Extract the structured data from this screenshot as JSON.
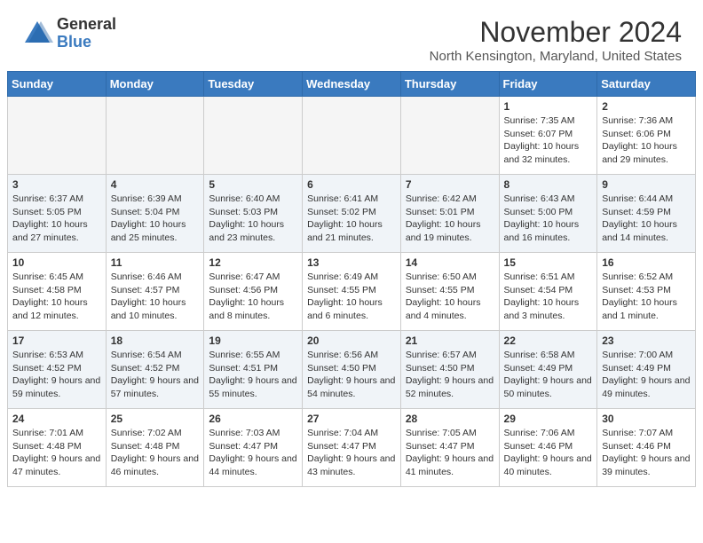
{
  "header": {
    "logo_general": "General",
    "logo_blue": "Blue",
    "title": "November 2024",
    "location": "North Kensington, Maryland, United States"
  },
  "days_of_week": [
    "Sunday",
    "Monday",
    "Tuesday",
    "Wednesday",
    "Thursday",
    "Friday",
    "Saturday"
  ],
  "weeks": [
    [
      {
        "day": "",
        "info": ""
      },
      {
        "day": "",
        "info": ""
      },
      {
        "day": "",
        "info": ""
      },
      {
        "day": "",
        "info": ""
      },
      {
        "day": "",
        "info": ""
      },
      {
        "day": "1",
        "info": "Sunrise: 7:35 AM\nSunset: 6:07 PM\nDaylight: 10 hours and 32 minutes."
      },
      {
        "day": "2",
        "info": "Sunrise: 7:36 AM\nSunset: 6:06 PM\nDaylight: 10 hours and 29 minutes."
      }
    ],
    [
      {
        "day": "3",
        "info": "Sunrise: 6:37 AM\nSunset: 5:05 PM\nDaylight: 10 hours and 27 minutes."
      },
      {
        "day": "4",
        "info": "Sunrise: 6:39 AM\nSunset: 5:04 PM\nDaylight: 10 hours and 25 minutes."
      },
      {
        "day": "5",
        "info": "Sunrise: 6:40 AM\nSunset: 5:03 PM\nDaylight: 10 hours and 23 minutes."
      },
      {
        "day": "6",
        "info": "Sunrise: 6:41 AM\nSunset: 5:02 PM\nDaylight: 10 hours and 21 minutes."
      },
      {
        "day": "7",
        "info": "Sunrise: 6:42 AM\nSunset: 5:01 PM\nDaylight: 10 hours and 19 minutes."
      },
      {
        "day": "8",
        "info": "Sunrise: 6:43 AM\nSunset: 5:00 PM\nDaylight: 10 hours and 16 minutes."
      },
      {
        "day": "9",
        "info": "Sunrise: 6:44 AM\nSunset: 4:59 PM\nDaylight: 10 hours and 14 minutes."
      }
    ],
    [
      {
        "day": "10",
        "info": "Sunrise: 6:45 AM\nSunset: 4:58 PM\nDaylight: 10 hours and 12 minutes."
      },
      {
        "day": "11",
        "info": "Sunrise: 6:46 AM\nSunset: 4:57 PM\nDaylight: 10 hours and 10 minutes."
      },
      {
        "day": "12",
        "info": "Sunrise: 6:47 AM\nSunset: 4:56 PM\nDaylight: 10 hours and 8 minutes."
      },
      {
        "day": "13",
        "info": "Sunrise: 6:49 AM\nSunset: 4:55 PM\nDaylight: 10 hours and 6 minutes."
      },
      {
        "day": "14",
        "info": "Sunrise: 6:50 AM\nSunset: 4:55 PM\nDaylight: 10 hours and 4 minutes."
      },
      {
        "day": "15",
        "info": "Sunrise: 6:51 AM\nSunset: 4:54 PM\nDaylight: 10 hours and 3 minutes."
      },
      {
        "day": "16",
        "info": "Sunrise: 6:52 AM\nSunset: 4:53 PM\nDaylight: 10 hours and 1 minute."
      }
    ],
    [
      {
        "day": "17",
        "info": "Sunrise: 6:53 AM\nSunset: 4:52 PM\nDaylight: 9 hours and 59 minutes."
      },
      {
        "day": "18",
        "info": "Sunrise: 6:54 AM\nSunset: 4:52 PM\nDaylight: 9 hours and 57 minutes."
      },
      {
        "day": "19",
        "info": "Sunrise: 6:55 AM\nSunset: 4:51 PM\nDaylight: 9 hours and 55 minutes."
      },
      {
        "day": "20",
        "info": "Sunrise: 6:56 AM\nSunset: 4:50 PM\nDaylight: 9 hours and 54 minutes."
      },
      {
        "day": "21",
        "info": "Sunrise: 6:57 AM\nSunset: 4:50 PM\nDaylight: 9 hours and 52 minutes."
      },
      {
        "day": "22",
        "info": "Sunrise: 6:58 AM\nSunset: 4:49 PM\nDaylight: 9 hours and 50 minutes."
      },
      {
        "day": "23",
        "info": "Sunrise: 7:00 AM\nSunset: 4:49 PM\nDaylight: 9 hours and 49 minutes."
      }
    ],
    [
      {
        "day": "24",
        "info": "Sunrise: 7:01 AM\nSunset: 4:48 PM\nDaylight: 9 hours and 47 minutes."
      },
      {
        "day": "25",
        "info": "Sunrise: 7:02 AM\nSunset: 4:48 PM\nDaylight: 9 hours and 46 minutes."
      },
      {
        "day": "26",
        "info": "Sunrise: 7:03 AM\nSunset: 4:47 PM\nDaylight: 9 hours and 44 minutes."
      },
      {
        "day": "27",
        "info": "Sunrise: 7:04 AM\nSunset: 4:47 PM\nDaylight: 9 hours and 43 minutes."
      },
      {
        "day": "28",
        "info": "Sunrise: 7:05 AM\nSunset: 4:47 PM\nDaylight: 9 hours and 41 minutes."
      },
      {
        "day": "29",
        "info": "Sunrise: 7:06 AM\nSunset: 4:46 PM\nDaylight: 9 hours and 40 minutes."
      },
      {
        "day": "30",
        "info": "Sunrise: 7:07 AM\nSunset: 4:46 PM\nDaylight: 9 hours and 39 minutes."
      }
    ]
  ]
}
